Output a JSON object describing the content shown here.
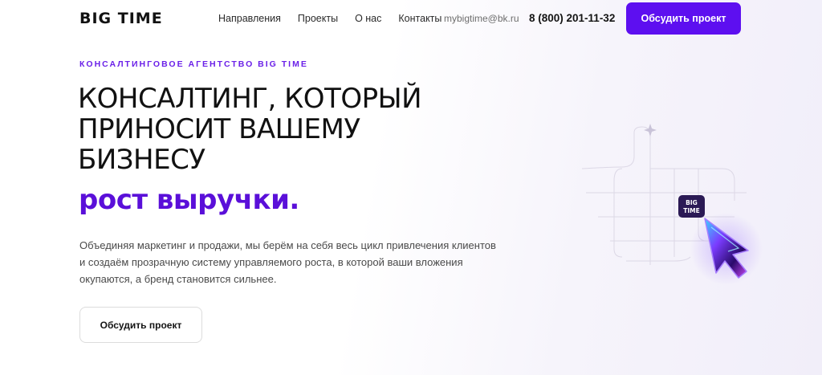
{
  "header": {
    "logo": "BIG TIME",
    "nav": [
      "Направления",
      "Проекты",
      "О нас",
      "Контакты"
    ],
    "email": "mybigtime@bk.ru",
    "phone": "8 (800) 201-11-32",
    "cta_label": "Обсудить проект"
  },
  "hero": {
    "eyebrow": "КОНСАЛТИНГОВОЕ АГЕНТСТВО BIG TIME",
    "headline_lines": [
      "КОНСАЛТИНГ, КОТОРЫЙ",
      "ПРИНОСИТ ВАШЕМУ",
      "БИЗНЕСУ"
    ],
    "accent": "рост выручки.",
    "description_lines": [
      "Объединяя маркетинг и продажи, мы берём на себя весь цикл привлечения клиентов",
      "и создаём прозрачную систему управляемого роста, в которой ваши вложения",
      "окупаются, а бренд становится сильнее."
    ],
    "cta_label": "Обсудить проект",
    "badge_lines": [
      "BIG",
      "TIME"
    ]
  },
  "colors": {
    "accent": "#5d0ff0",
    "eyebrow": "#6a1fe8",
    "text": "#111111"
  },
  "icons": [
    "cursor-arrow-icon",
    "sparkle-icon"
  ]
}
